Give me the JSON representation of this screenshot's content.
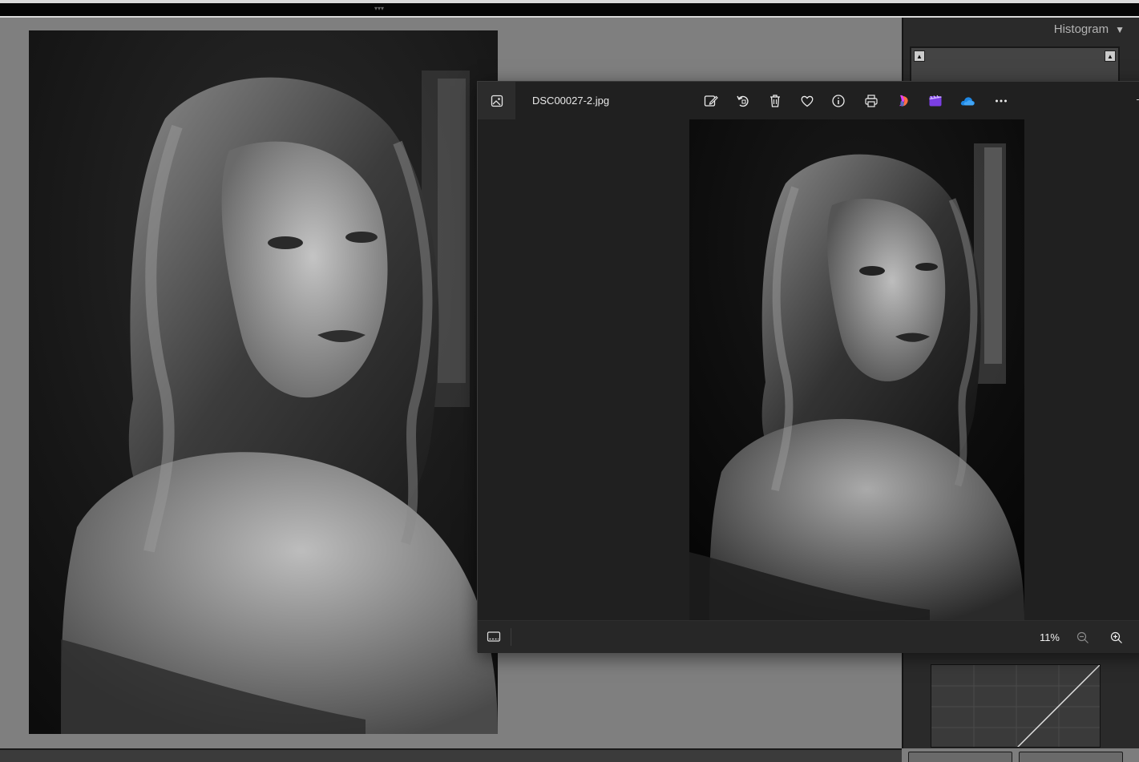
{
  "lightroom": {
    "panel_title": "Histogram",
    "panel_toggle_icon": "triangle-down-icon"
  },
  "viewer": {
    "filename": "DSC00027-2.jpg",
    "toolbar_icons": [
      "edit-image-icon",
      "rotate-icon",
      "delete-icon",
      "favorite-icon",
      "info-icon",
      "print-icon",
      "copilot-icon",
      "clipchamp-icon",
      "onedrive-icon",
      "more-icon"
    ],
    "zoom_level": "11%",
    "colors": {
      "window_bg": "#202020",
      "toolbar_bg": "#202020",
      "footer_bg": "#272727",
      "onedrive_blue": "#1e88e5",
      "clipchamp_purple": "#7b3fe4"
    }
  }
}
